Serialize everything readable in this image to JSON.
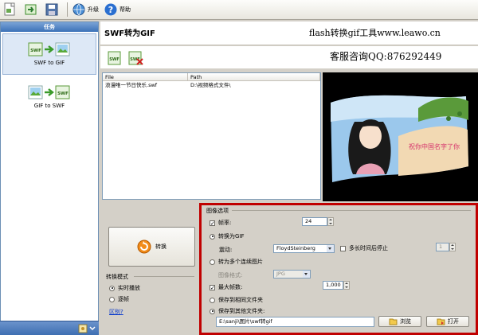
{
  "toolbar": {
    "upgrade_label": "升级",
    "help_label": "帮助"
  },
  "sidebar": {
    "title": "任务",
    "tasks": [
      {
        "label": "SWF to GIF",
        "selected": true
      },
      {
        "label": "GIF to SWF",
        "selected": false
      }
    ]
  },
  "header": {
    "title": "SWF转为GIF",
    "promo_url": "flash转换gif工具www.leawo.cn",
    "promo_qq": "客服咨询QQ:876292449"
  },
  "filelist": {
    "columns": [
      "File",
      "Path"
    ],
    "rows": [
      {
        "file": "浪漫唯一节日快乐.swf",
        "path": "D:\\视频格式文件\\"
      }
    ]
  },
  "preview": {
    "banner_text": "祝你中国名字了你"
  },
  "convert": {
    "button_label": "转换"
  },
  "mode": {
    "label": "转换模式",
    "options": [
      {
        "label": "实时播放",
        "selected": true
      },
      {
        "label": "逐帧",
        "selected": false
      }
    ],
    "link": "区别?"
  },
  "options": {
    "label": "图像选项",
    "frame_rate": {
      "label": "帧率:",
      "checked": true,
      "value": "24"
    },
    "to_gif": {
      "label": "转换为GIF",
      "selected": true
    },
    "dither": {
      "label": "震动:",
      "value": "FloydSteinberg"
    },
    "stop_after": {
      "label": "多长时间后停止",
      "checked": false,
      "value": "1"
    },
    "to_images": {
      "label": "转为多个连续图片",
      "selected": false
    },
    "image_format": {
      "label": "图像格式:",
      "value": "JPG"
    },
    "max_frames": {
      "label": "最大帧数:",
      "checked": true,
      "value": "1,000"
    },
    "save_same": {
      "label": "保存到相同文件夹",
      "selected": false
    },
    "save_other": {
      "label": "保存到其他文件夹:",
      "selected": true
    },
    "output_path": "E:\\sanji\\图片\\swf转gif",
    "browse_label": "浏览",
    "open_label": "打开"
  },
  "colors": {
    "accent_blue": "#3c72b8",
    "highlight_red": "#c00000"
  }
}
